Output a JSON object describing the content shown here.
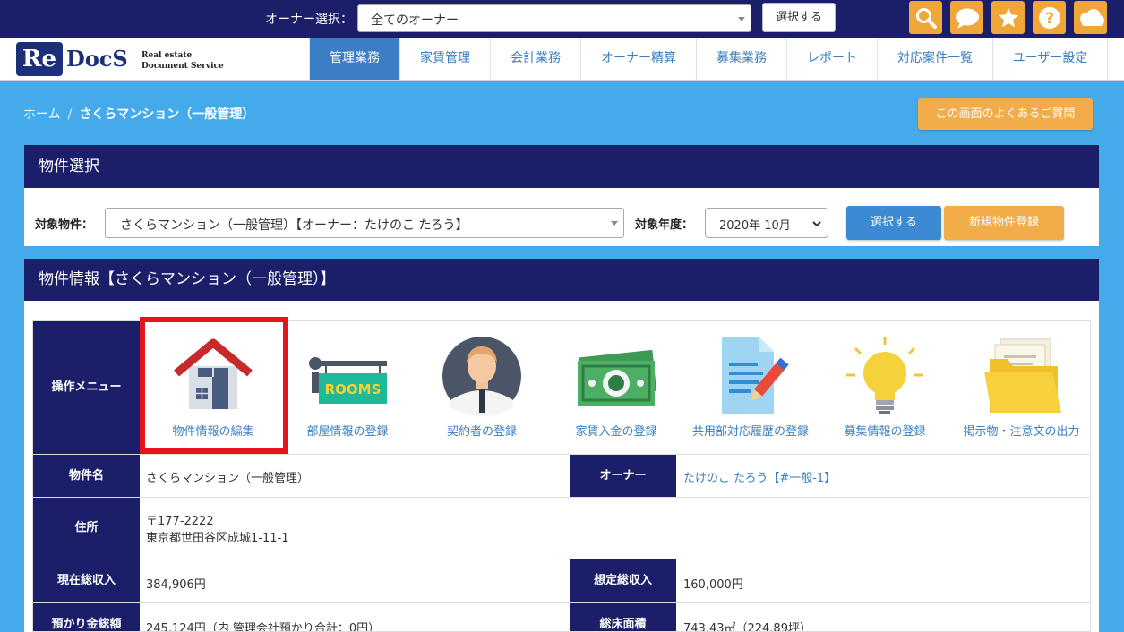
{
  "topbar": {
    "owner_label": "オーナー選択：",
    "owner_select_value": "全てのオーナー",
    "select_button": "選択する",
    "icons": [
      "search-icon",
      "chat-icon",
      "star-icon",
      "help-icon",
      "cloud-icon"
    ],
    "accent": "#f0a638",
    "bg": "#1b1f6a"
  },
  "logo": {
    "re": "Re",
    "docs": "DocS",
    "sub1": "Real estate",
    "sub2": "Document Service"
  },
  "nav": {
    "items": [
      "管理業務",
      "家賃管理",
      "会計業務",
      "オーナー精算",
      "募集業務",
      "レポート",
      "対応案件一覧",
      "ユーザー設定"
    ],
    "active_index": 0
  },
  "breadcrumb": {
    "home": "ホーム",
    "separator": "/",
    "current": "さくらマンション（一般管理）"
  },
  "faq_button": "この画面のよくあるご質問",
  "property_select": {
    "title": "物件選択",
    "target_label": "対象物件：",
    "target_value": "さくらマンション（一般管理）【オーナー：たけのこ たろう】",
    "year_label": "対象年度：",
    "year_value": "2020年 10月",
    "select_button": "選択する",
    "new_button": "新規物件登録"
  },
  "property_info": {
    "title": "物件情報【さくらマンション（一般管理）】",
    "menu_label": "操作メニュー",
    "menu": [
      {
        "label": "物件情報の編集",
        "icon": "house-icon"
      },
      {
        "label": "部屋情報の登録",
        "icon": "rooms-sign-icon"
      },
      {
        "label": "契約者の登録",
        "icon": "person-icon"
      },
      {
        "label": "家賃入金の登録",
        "icon": "money-icon"
      },
      {
        "label": "共用部対応履歴の登録",
        "icon": "document-pen-icon"
      },
      {
        "label": "募集情報の登録",
        "icon": "lightbulb-icon"
      },
      {
        "label": "掲示物・注意文の出力",
        "icon": "folder-icon"
      }
    ],
    "rows": {
      "name_label": "物件名",
      "name_value": "さくらマンション（一般管理）",
      "owner_label": "オーナー",
      "owner_value": "たけのこ たろう【#一般-1】",
      "address_label": "住所",
      "address_zip": "〒177-2222",
      "address_line": "東京都世田谷区成城1-11-1",
      "current_income_label": "現在総収入",
      "current_income_value": "384,906円",
      "expected_income_label": "想定総収入",
      "expected_income_value": "160,000円",
      "deposit_label": "預かり金総額",
      "deposit_value": "245,124円（内 管理会社預かり合計：0円）",
      "floor_area_label": "総床面積",
      "floor_area_value": "743.43㎡（224.89坪）"
    }
  }
}
